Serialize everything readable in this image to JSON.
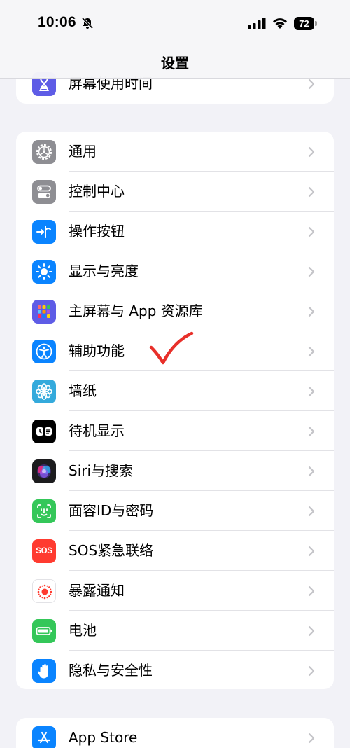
{
  "status_bar": {
    "time": "10:06",
    "battery_percent": "72",
    "icons": [
      "bell-slash-icon",
      "cellular-signal-icon",
      "wifi-icon",
      "battery-icon"
    ]
  },
  "nav": {
    "title": "设置"
  },
  "group_top": {
    "items": [
      {
        "label": "屏幕使用时间",
        "icon": "hourglass-icon",
        "icon_color": "#5e5ce6"
      }
    ]
  },
  "group_main": {
    "items": [
      {
        "label": "通用",
        "icon": "gear-icon",
        "icon_color": "#8e8e93"
      },
      {
        "label": "控制中心",
        "icon": "toggles-icon",
        "icon_color": "#8e8e93"
      },
      {
        "label": "操作按钮",
        "icon": "action-button-icon",
        "icon_color": "#0a84ff"
      },
      {
        "label": "显示与亮度",
        "icon": "sun-icon",
        "icon_color": "#0a84ff"
      },
      {
        "label": "主屏幕与 App 资源库",
        "icon": "home-screen-grid-icon",
        "icon_color": "#5e5ce6"
      },
      {
        "label": "辅助功能",
        "icon": "accessibility-icon",
        "icon_color": "#0a84ff"
      },
      {
        "label": "墙纸",
        "icon": "wallpaper-flower-icon",
        "icon_color": "#34aadc"
      },
      {
        "label": "待机显示",
        "icon": "standby-icon",
        "icon_color": "#000000"
      },
      {
        "label": "Siri与搜索",
        "icon": "siri-icon",
        "icon_color": "#1c1c1e"
      },
      {
        "label": "面容ID与密码",
        "icon": "face-id-icon",
        "icon_color": "#34c759"
      },
      {
        "label": "SOS紧急联络",
        "icon": "sos-icon",
        "icon_color": "#ff3b30"
      },
      {
        "label": "暴露通知",
        "icon": "exposure-notification-icon",
        "icon_color": "#ffffff"
      },
      {
        "label": "电池",
        "icon": "battery-icon",
        "icon_color": "#34c759"
      },
      {
        "label": "隐私与安全性",
        "icon": "hand-icon",
        "icon_color": "#0a84ff"
      }
    ],
    "sos_badge": "SOS"
  },
  "group_bottom": {
    "items": [
      {
        "label": "App Store",
        "icon": "app-store-icon",
        "icon_color": "#0a84ff"
      }
    ]
  },
  "annotation": {
    "mark": "red-checkmark",
    "color": "#e8302a"
  }
}
